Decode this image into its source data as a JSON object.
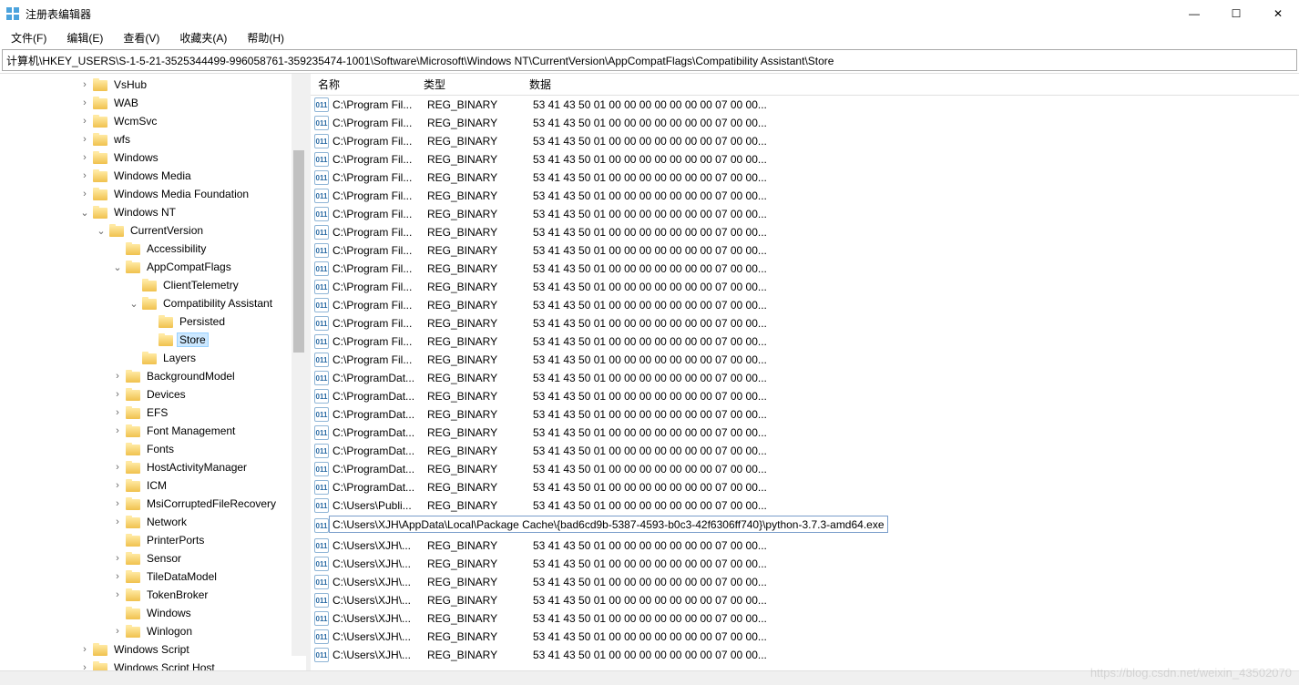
{
  "window": {
    "title": "注册表编辑器",
    "min": "—",
    "max": "☐",
    "close": "✕"
  },
  "menu": {
    "file": "文件(F)",
    "edit": "编辑(E)",
    "view": "查看(V)",
    "favorites": "收藏夹(A)",
    "help": "帮助(H)"
  },
  "address": "计算机\\HKEY_USERS\\S-1-5-21-3525344499-996058761-359235474-1001\\Software\\Microsoft\\Windows NT\\CurrentVersion\\AppCompatFlags\\Compatibility Assistant\\Store",
  "list": {
    "headers": {
      "name": "名称",
      "type": "类型",
      "data": "数据"
    },
    "hexdata": "53 41 43 50 01 00 00 00 00 00 00 00 07 00 00...",
    "editValue": "C:\\Users\\XJH\\AppData\\Local\\Package Cache\\{bad6cd9b-5387-4593-b0c3-42f6306ff740}\\python-3.7.3-amd64.exe",
    "rows": [
      {
        "name": "C:\\Program Fil...",
        "type": "REG_BINARY"
      },
      {
        "name": "C:\\Program Fil...",
        "type": "REG_BINARY"
      },
      {
        "name": "C:\\Program Fil...",
        "type": "REG_BINARY"
      },
      {
        "name": "C:\\Program Fil...",
        "type": "REG_BINARY"
      },
      {
        "name": "C:\\Program Fil...",
        "type": "REG_BINARY"
      },
      {
        "name": "C:\\Program Fil...",
        "type": "REG_BINARY"
      },
      {
        "name": "C:\\Program Fil...",
        "type": "REG_BINARY"
      },
      {
        "name": "C:\\Program Fil...",
        "type": "REG_BINARY"
      },
      {
        "name": "C:\\Program Fil...",
        "type": "REG_BINARY"
      },
      {
        "name": "C:\\Program Fil...",
        "type": "REG_BINARY"
      },
      {
        "name": "C:\\Program Fil...",
        "type": "REG_BINARY"
      },
      {
        "name": "C:\\Program Fil...",
        "type": "REG_BINARY"
      },
      {
        "name": "C:\\Program Fil...",
        "type": "REG_BINARY"
      },
      {
        "name": "C:\\Program Fil...",
        "type": "REG_BINARY"
      },
      {
        "name": "C:\\Program Fil...",
        "type": "REG_BINARY"
      },
      {
        "name": "C:\\ProgramDat...",
        "type": "REG_BINARY"
      },
      {
        "name": "C:\\ProgramDat...",
        "type": "REG_BINARY"
      },
      {
        "name": "C:\\ProgramDat...",
        "type": "REG_BINARY"
      },
      {
        "name": "C:\\ProgramDat...",
        "type": "REG_BINARY"
      },
      {
        "name": "C:\\ProgramDat...",
        "type": "REG_BINARY"
      },
      {
        "name": "C:\\ProgramDat...",
        "type": "REG_BINARY"
      },
      {
        "name": "C:\\ProgramDat...",
        "type": "REG_BINARY"
      },
      {
        "name": "C:\\Users\\Publi...",
        "type": "REG_BINARY"
      },
      {
        "name": "__EDIT__"
      },
      {
        "name": "C:\\Users\\XJH\\...",
        "type": "REG_BINARY"
      },
      {
        "name": "C:\\Users\\XJH\\...",
        "type": "REG_BINARY"
      },
      {
        "name": "C:\\Users\\XJH\\...",
        "type": "REG_BINARY"
      },
      {
        "name": "C:\\Users\\XJH\\...",
        "type": "REG_BINARY"
      },
      {
        "name": "C:\\Users\\XJH\\...",
        "type": "REG_BINARY"
      },
      {
        "name": "C:\\Users\\XJH\\...",
        "type": "REG_BINARY"
      },
      {
        "name": "C:\\Users\\XJH\\...",
        "type": "REG_BINARY"
      }
    ]
  },
  "tree": [
    {
      "indent": 86,
      "toggle": ">",
      "label": "VsHub"
    },
    {
      "indent": 86,
      "toggle": ">",
      "label": "WAB"
    },
    {
      "indent": 86,
      "toggle": ">",
      "label": "WcmSvc"
    },
    {
      "indent": 86,
      "toggle": ">",
      "label": "wfs"
    },
    {
      "indent": 86,
      "toggle": ">",
      "label": "Windows"
    },
    {
      "indent": 86,
      "toggle": ">",
      "label": "Windows Media"
    },
    {
      "indent": 86,
      "toggle": ">",
      "label": "Windows Media Foundation"
    },
    {
      "indent": 86,
      "toggle": "v",
      "label": "Windows NT"
    },
    {
      "indent": 104,
      "toggle": "v",
      "label": "CurrentVersion"
    },
    {
      "indent": 122,
      "toggle": "",
      "label": "Accessibility"
    },
    {
      "indent": 122,
      "toggle": "v",
      "label": "AppCompatFlags"
    },
    {
      "indent": 140,
      "toggle": "",
      "label": "ClientTelemetry"
    },
    {
      "indent": 140,
      "toggle": "v",
      "label": "Compatibility Assistant"
    },
    {
      "indent": 158,
      "toggle": "",
      "label": "Persisted"
    },
    {
      "indent": 158,
      "toggle": "",
      "label": "Store",
      "selected": true
    },
    {
      "indent": 140,
      "toggle": "",
      "label": "Layers"
    },
    {
      "indent": 122,
      "toggle": ">",
      "label": "BackgroundModel"
    },
    {
      "indent": 122,
      "toggle": ">",
      "label": "Devices"
    },
    {
      "indent": 122,
      "toggle": ">",
      "label": "EFS"
    },
    {
      "indent": 122,
      "toggle": ">",
      "label": "Font Management"
    },
    {
      "indent": 122,
      "toggle": "",
      "label": "Fonts"
    },
    {
      "indent": 122,
      "toggle": ">",
      "label": "HostActivityManager"
    },
    {
      "indent": 122,
      "toggle": ">",
      "label": "ICM"
    },
    {
      "indent": 122,
      "toggle": ">",
      "label": "MsiCorruptedFileRecovery"
    },
    {
      "indent": 122,
      "toggle": ">",
      "label": "Network"
    },
    {
      "indent": 122,
      "toggle": "",
      "label": "PrinterPorts"
    },
    {
      "indent": 122,
      "toggle": ">",
      "label": "Sensor"
    },
    {
      "indent": 122,
      "toggle": ">",
      "label": "TileDataModel"
    },
    {
      "indent": 122,
      "toggle": ">",
      "label": "TokenBroker"
    },
    {
      "indent": 122,
      "toggle": "",
      "label": "Windows"
    },
    {
      "indent": 122,
      "toggle": ">",
      "label": "Winlogon"
    },
    {
      "indent": 86,
      "toggle": ">",
      "label": "Windows Script"
    },
    {
      "indent": 86,
      "toggle": ">",
      "label": "Windows Script Host"
    }
  ],
  "watermark": "https://blog.csdn.net/weixin_43502070"
}
